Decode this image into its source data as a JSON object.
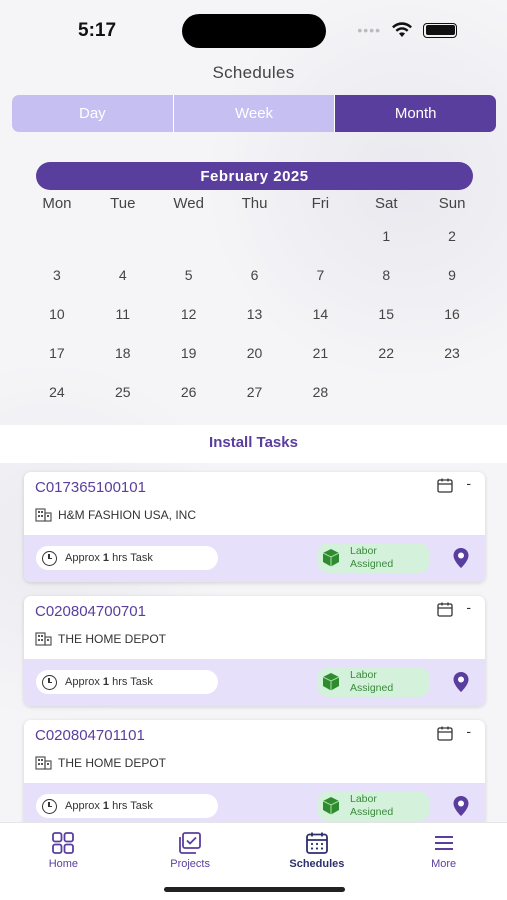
{
  "status_bar": {
    "time": "5:17",
    "dots": "••••"
  },
  "page_title": "Schedules",
  "segments": [
    {
      "label": "Day",
      "active": false
    },
    {
      "label": "Week",
      "active": false
    },
    {
      "label": "Month",
      "active": true
    }
  ],
  "calendar": {
    "month_label": "February  2025",
    "weekdays": [
      "Mon",
      "Tue",
      "Wed",
      "Thu",
      "Fri",
      "Sat",
      "Sun"
    ],
    "days": [
      "",
      "",
      "",
      "",
      "",
      "1",
      "2",
      "3",
      "4",
      "5",
      "6",
      "7",
      "8",
      "9",
      "10",
      "11",
      "12",
      "13",
      "14",
      "15",
      "16",
      "17",
      "18",
      "19",
      "20",
      "21",
      "22",
      "23",
      "24",
      "25",
      "26",
      "27",
      "28",
      "",
      ""
    ]
  },
  "install_title": "Install Tasks",
  "tasks": [
    {
      "id": "C017365100101",
      "company": "H&M FASHION USA, INC",
      "approx_prefix": "Approx ",
      "approx_hours": "1",
      "approx_suffix": " hrs Task",
      "labor_line1": "Labor",
      "labor_line2": "Assigned",
      "menu": "-"
    },
    {
      "id": "C020804700701",
      "company": "THE HOME DEPOT",
      "approx_prefix": "Approx ",
      "approx_hours": "1",
      "approx_suffix": " hrs Task",
      "labor_line1": "Labor",
      "labor_line2": "Assigned",
      "menu": "-"
    },
    {
      "id": "C020804701101",
      "company": "THE HOME DEPOT",
      "approx_prefix": "Approx ",
      "approx_hours": "1",
      "approx_suffix": " hrs Task",
      "labor_line1": "Labor",
      "labor_line2": "Assigned",
      "menu": "-"
    }
  ],
  "tabbar": [
    {
      "label": "Home",
      "icon": "grid-icon",
      "active": false
    },
    {
      "label": "Projects",
      "icon": "projects-icon",
      "active": false
    },
    {
      "label": "Schedules",
      "icon": "calendar-icon",
      "active": true
    },
    {
      "label": "More",
      "icon": "menu-icon",
      "active": false
    }
  ],
  "colors": {
    "primary": "#5a3e9e",
    "segment_inactive": "#c5bff2",
    "card_bottom": "#e6e0fb",
    "labor_bg": "#d4f1dc",
    "labor_text": "#3a8a3a"
  }
}
